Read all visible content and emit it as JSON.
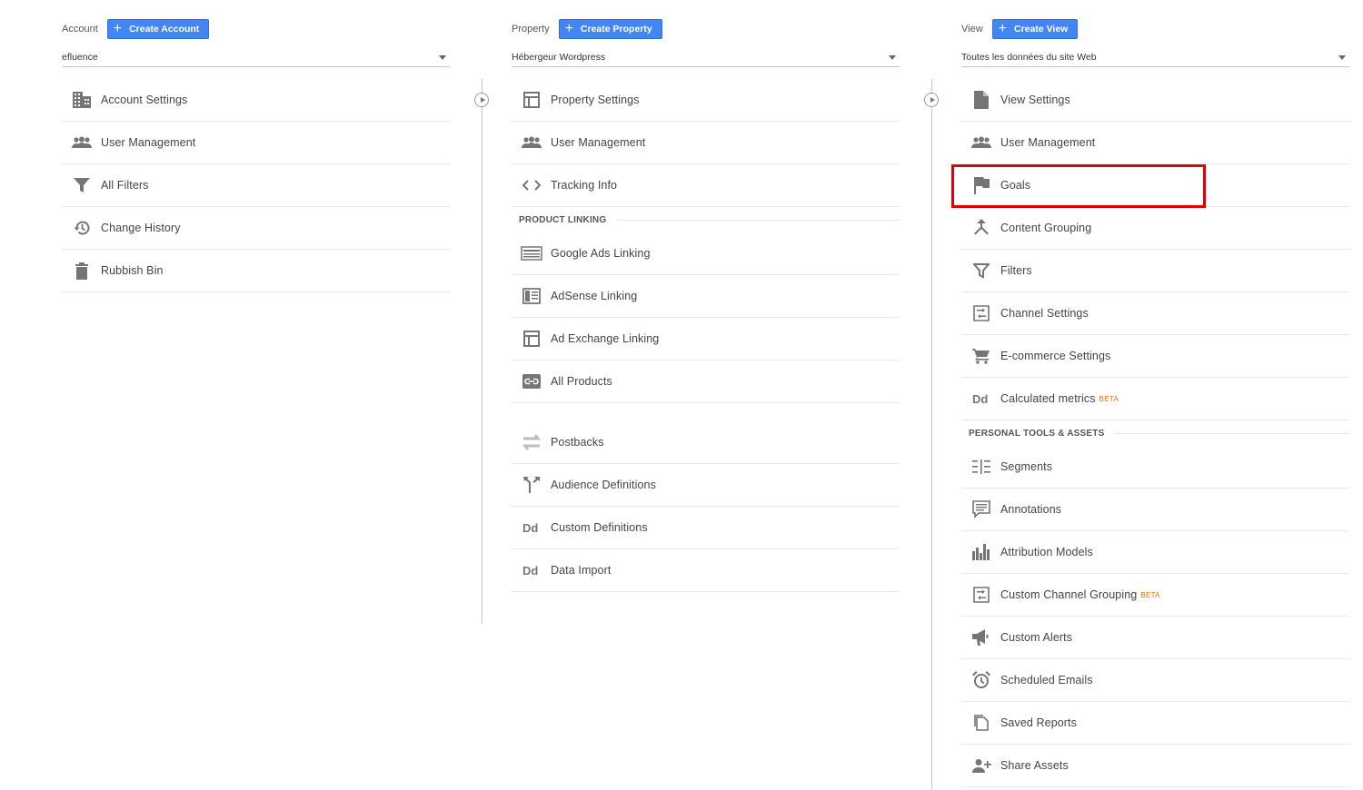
{
  "account": {
    "label": "Account",
    "create_label": "Create Account",
    "selected": "efluence",
    "items": [
      {
        "label": "Account Settings",
        "icon": "building-icon"
      },
      {
        "label": "User Management",
        "icon": "people-icon"
      },
      {
        "label": "All Filters",
        "icon": "filter-icon"
      },
      {
        "label": "Change History",
        "icon": "history-icon"
      },
      {
        "label": "Rubbish Bin",
        "icon": "trash-icon"
      }
    ]
  },
  "property": {
    "label": "Property",
    "create_label": "Create Property",
    "selected": "Hébergeur Wordpress",
    "items": [
      {
        "label": "Property Settings",
        "icon": "window-icon"
      },
      {
        "label": "User Management",
        "icon": "people-icon"
      },
      {
        "label": "Tracking Info",
        "icon": "code-icon"
      }
    ],
    "product_linking_heading": "PRODUCT LINKING",
    "linking_items": [
      {
        "label": "Google Ads Linking",
        "icon": "ads-icon"
      },
      {
        "label": "AdSense Linking",
        "icon": "adsense-icon"
      },
      {
        "label": "Ad Exchange Linking",
        "icon": "window-icon"
      },
      {
        "label": "All Products",
        "icon": "link-icon"
      }
    ],
    "other_items": [
      {
        "label": "Postbacks",
        "icon": "postback-icon"
      },
      {
        "label": "Audience Definitions",
        "icon": "fork-icon"
      },
      {
        "label": "Custom Definitions",
        "icon": "dd-icon"
      },
      {
        "label": "Data Import",
        "icon": "dd-icon"
      }
    ]
  },
  "view": {
    "label": "View",
    "create_label": "Create View",
    "selected": "Toutes les données du site Web",
    "items": [
      {
        "label": "View Settings",
        "icon": "document-icon"
      },
      {
        "label": "User Management",
        "icon": "people-icon"
      },
      {
        "label": "Goals",
        "icon": "flag-icon"
      },
      {
        "label": "Content Grouping",
        "icon": "merge-icon"
      },
      {
        "label": "Filters",
        "icon": "filter-icon"
      },
      {
        "label": "Channel Settings",
        "icon": "channel-icon"
      },
      {
        "label": "E-commerce Settings",
        "icon": "cart-icon"
      },
      {
        "label": "Calculated metrics",
        "icon": "dd-icon",
        "badge": "BETA"
      }
    ],
    "personal_heading": "PERSONAL TOOLS & ASSETS",
    "personal_items": [
      {
        "label": "Segments",
        "icon": "segments-icon"
      },
      {
        "label": "Annotations",
        "icon": "comment-icon"
      },
      {
        "label": "Attribution Models",
        "icon": "bars-icon"
      },
      {
        "label": "Custom Channel Grouping",
        "icon": "channel-icon",
        "badge": "BETA"
      },
      {
        "label": "Custom Alerts",
        "icon": "megaphone-icon"
      },
      {
        "label": "Scheduled Emails",
        "icon": "alarm-icon"
      },
      {
        "label": "Saved Reports",
        "icon": "copy-icon"
      },
      {
        "label": "Share Assets",
        "icon": "person-add-icon"
      }
    ]
  },
  "colors": {
    "accent": "#4285f4",
    "highlight": "#e00000",
    "beta": "#e8710a",
    "icon": "#757575"
  }
}
